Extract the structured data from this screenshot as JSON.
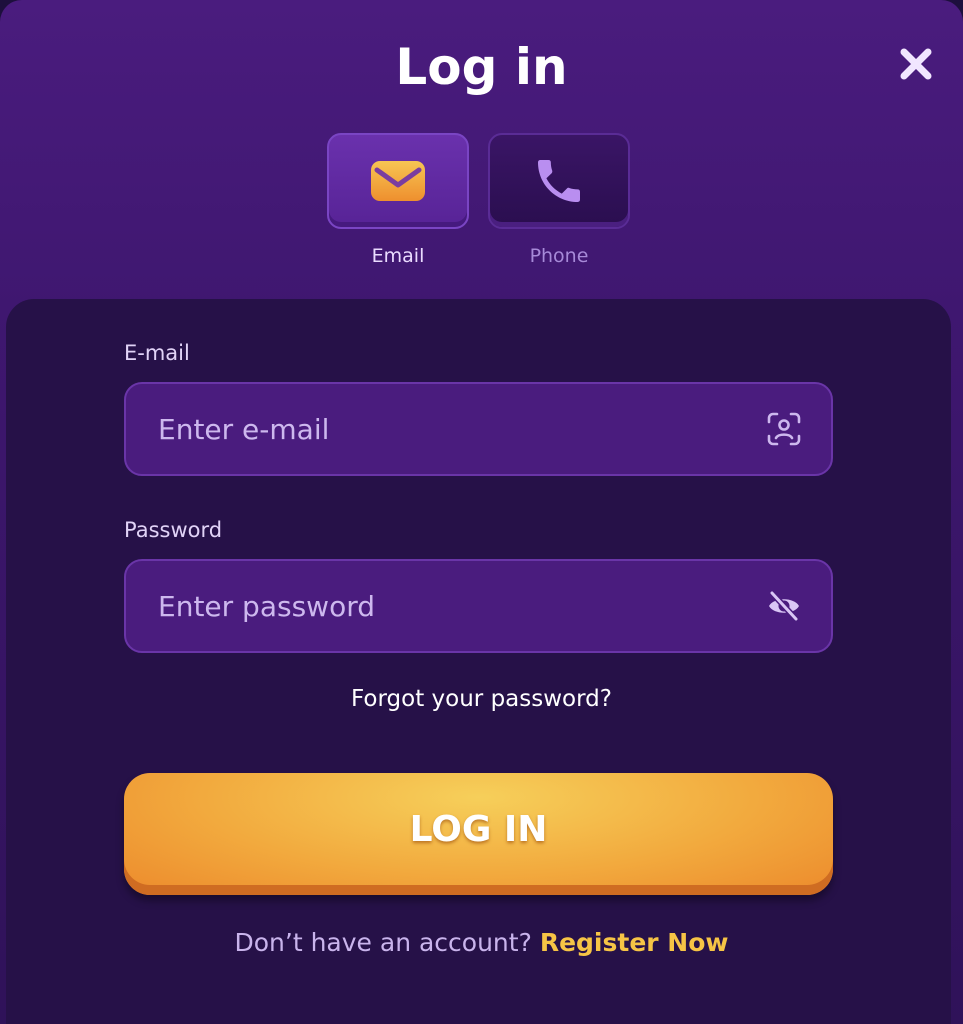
{
  "modal": {
    "title": "Log in",
    "close_icon": "close-icon"
  },
  "methods": [
    {
      "label": "Email",
      "icon": "envelope-icon",
      "selected": true
    },
    {
      "label": "Phone",
      "icon": "phone-icon",
      "selected": false
    }
  ],
  "form": {
    "email_label": "E-mail",
    "email_placeholder": "Enter e-mail",
    "email_value": "",
    "email_icon": "face-scan-icon",
    "password_label": "Password",
    "password_placeholder": "Enter password",
    "password_value": "",
    "password_icon": "eye-off-icon",
    "forgot_text": "Forgot your password?",
    "login_label": "LOG IN",
    "register_prompt": "Don’t have an account?",
    "register_link": "Register Now"
  },
  "colors": {
    "background": "#3f1770",
    "panel": "#261148",
    "input": "#4a1c7e",
    "accent": "#f2aa3e",
    "link": "#f6c445"
  }
}
